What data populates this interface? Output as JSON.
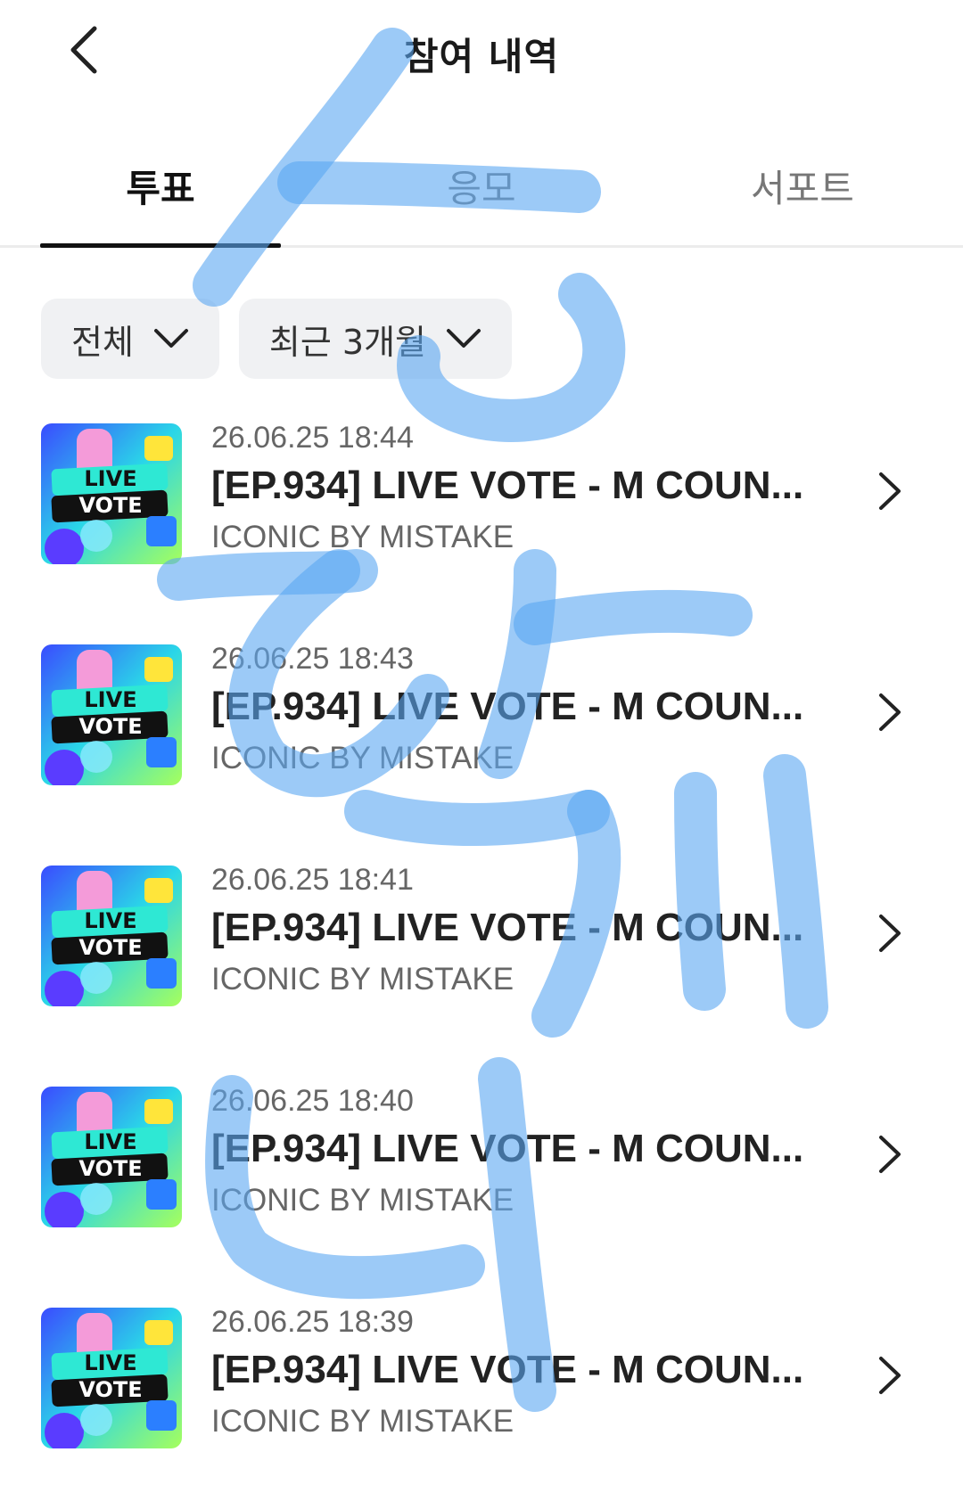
{
  "header": {
    "title": "참여 내역",
    "back_icon": "chevron-left-icon"
  },
  "tabs": [
    {
      "label": "투표",
      "active": true
    },
    {
      "label": "응모",
      "active": false
    },
    {
      "label": "서포트",
      "active": false
    }
  ],
  "filters": [
    {
      "label": "전체",
      "icon": "chevron-down-icon"
    },
    {
      "label": "최근 3개월",
      "icon": "chevron-down-icon"
    }
  ],
  "items": [
    {
      "date": "26.06.25 18:44",
      "title": "[EP.934] LIVE VOTE - M COUN...",
      "subtitle": "ICONIC BY MISTAKE",
      "thumb_line1": "LIVE",
      "thumb_line2": "VOTE"
    },
    {
      "date": "26.06.25 18:43",
      "title": "[EP.934] LIVE VOTE - M COUN...",
      "subtitle": "ICONIC BY MISTAKE",
      "thumb_line1": "LIVE",
      "thumb_line2": "VOTE"
    },
    {
      "date": "26.06.25 18:41",
      "title": "[EP.934] LIVE VOTE - M COUN...",
      "subtitle": "ICONIC BY MISTAKE",
      "thumb_line1": "LIVE",
      "thumb_line2": "VOTE"
    },
    {
      "date": "26.06.25 18:40",
      "title": "[EP.934] LIVE VOTE - M COUN...",
      "subtitle": "ICONIC BY MISTAKE",
      "thumb_line1": "LIVE",
      "thumb_line2": "VOTE"
    },
    {
      "date": "26.06.25 18:39",
      "title": "[EP.934] LIVE VOTE - M COUN...",
      "subtitle": "ICONIC BY MISTAKE",
      "thumb_line1": "LIVE",
      "thumb_line2": "VOTE"
    }
  ],
  "colors": {
    "scribble": "#5aa6f2",
    "chip_bg": "#f0f1f3",
    "tab_indicator": "#111111"
  }
}
